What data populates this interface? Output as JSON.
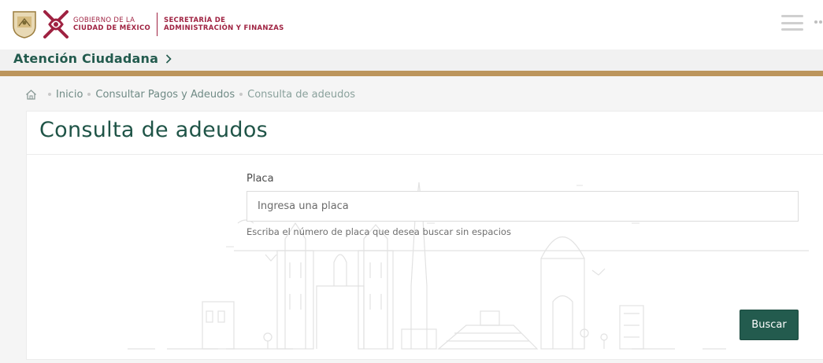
{
  "header": {
    "logo_line1": "GOBIERNO DE LA",
    "logo_line2": "CIUDAD DE MÉXICO",
    "secretaria_line1": "SECRETARÍA DE",
    "secretaria_line2": "ADMINISTRACIÓN Y FINANZAS"
  },
  "service": {
    "label": "Atención Ciudadana"
  },
  "breadcrumb": {
    "items": [
      "Inicio",
      "Consultar Pagos y Adeudos"
    ],
    "current": "Consulta de adeudos"
  },
  "page": {
    "title": "Consulta de adeudos"
  },
  "form": {
    "placa_label": "Placa",
    "placa_value": "",
    "placa_placeholder": "Ingresa una placa",
    "placa_help": "Escriba el número de placa que desea buscar sin espacios",
    "search_button": "Buscar"
  },
  "icons": {
    "home": "home-icon",
    "chevron": "chevron-right-icon",
    "menu": "hamburger-menu-icon",
    "more": "more-dots-icon"
  },
  "colors": {
    "primary_green": "#235b4e",
    "gold": "#bc955c",
    "brand_red": "#9f2241"
  }
}
